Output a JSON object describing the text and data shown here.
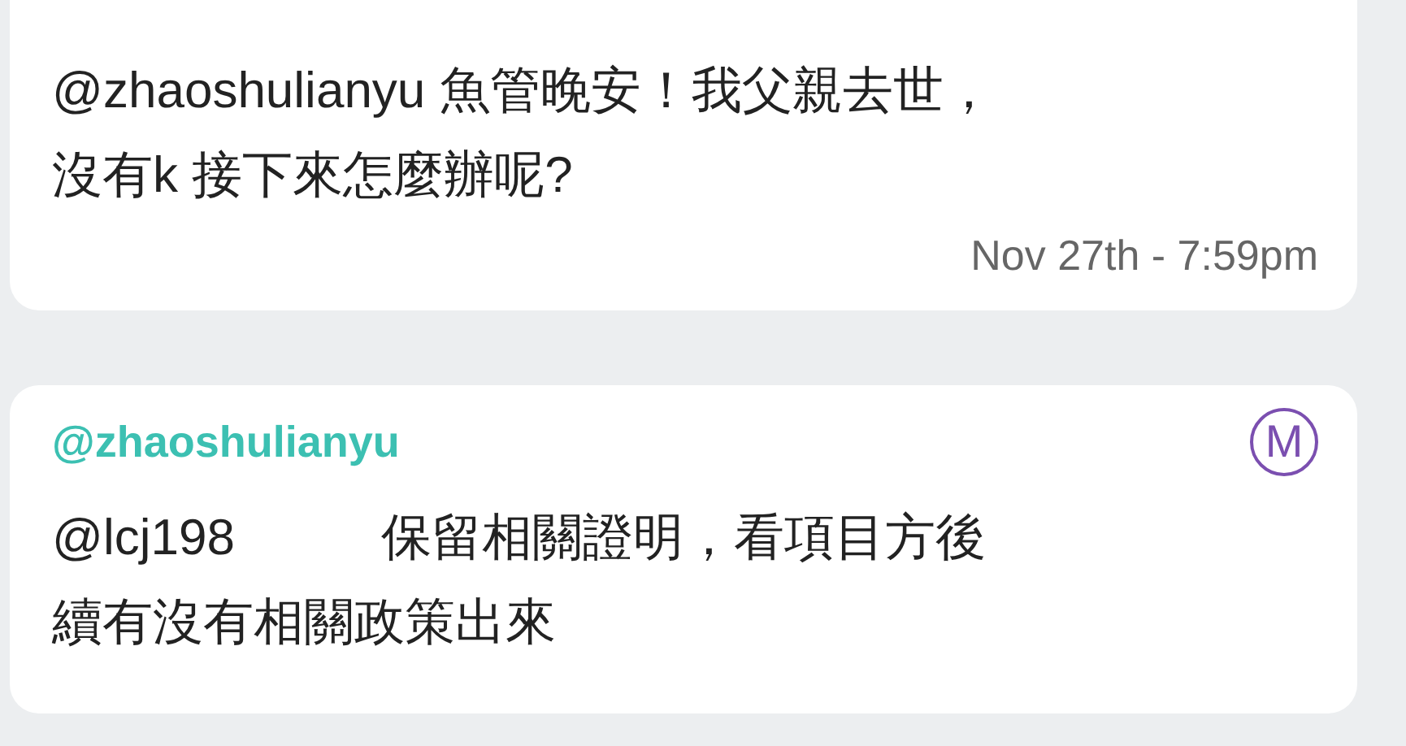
{
  "messages": [
    {
      "kind": "incoming",
      "lines": [
        "@zhaoshulianyu 魚管晚安！我父親去世，",
        "沒有k 接下來怎麼辦呢?"
      ],
      "time": "Nov 27th - 7:59pm"
    },
    {
      "kind": "reply",
      "author": "@zhaoshulianyu",
      "badge": "M",
      "mention": "@lcj198",
      "lines": [
        "保留相關證明，看項目方後",
        "續有沒有相關政策出來"
      ]
    }
  ]
}
